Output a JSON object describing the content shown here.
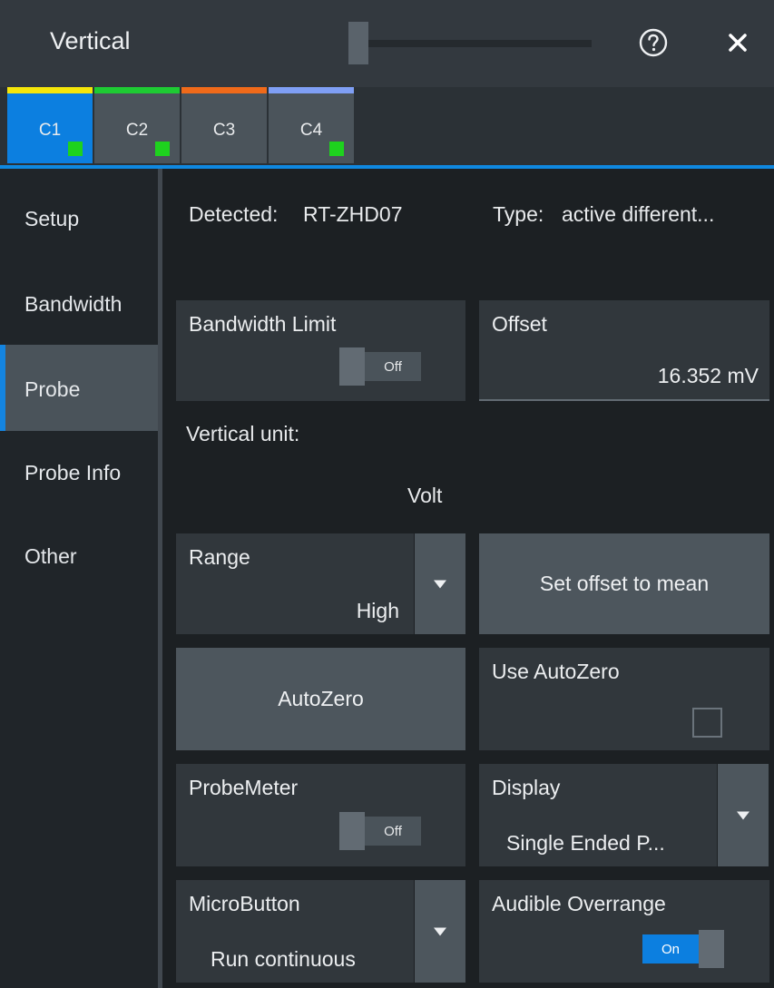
{
  "window": {
    "title": "Vertical",
    "help_icon": "help-circle-icon",
    "close_icon": "close-icon"
  },
  "tabs": [
    {
      "label": "C1",
      "color": "#f5e60a",
      "active": true
    },
    {
      "label": "C2",
      "color": "#1ecb33",
      "active": false
    },
    {
      "label": "C3",
      "color": "#f06a1a",
      "active": false
    },
    {
      "label": "C4",
      "color": "#7f9ff5",
      "active": false
    }
  ],
  "sidebar": {
    "items": [
      {
        "label": "Setup",
        "active": false
      },
      {
        "label": "Bandwidth",
        "active": false
      },
      {
        "label": "Probe",
        "active": true
      },
      {
        "label": "Probe Info",
        "active": false
      },
      {
        "label": "Other",
        "active": false
      }
    ]
  },
  "probe": {
    "detected_label": "Detected:",
    "detected_value": "RT-ZHD07",
    "type_label": "Type:",
    "type_value": "active different...",
    "bandwidth_limit": {
      "label": "Bandwidth Limit",
      "state": "Off"
    },
    "offset": {
      "label": "Offset",
      "value": "16.352 mV"
    },
    "vertical_unit": {
      "label": "Vertical unit:",
      "value": "Volt"
    },
    "range": {
      "label": "Range",
      "value": "High"
    },
    "set_offset_button": "Set offset to mean",
    "autozero_button": "AutoZero",
    "use_autozero": {
      "label": "Use AutoZero",
      "checked": false
    },
    "probemeter": {
      "label": "ProbeMeter",
      "state": "Off"
    },
    "display": {
      "label": "Display",
      "value": "Single Ended P..."
    },
    "microbutton": {
      "label": "MicroButton",
      "value": "Run continuous"
    },
    "audible_overrange": {
      "label": "Audible Overrange",
      "state": "On"
    }
  },
  "colors": {
    "accent": "#0c7fe0",
    "status_marker": "#1ed21e"
  }
}
